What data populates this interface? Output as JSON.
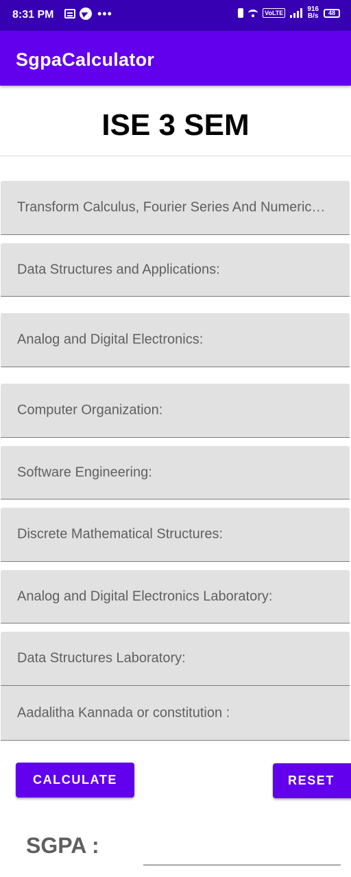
{
  "status_bar": {
    "time": "8:31 PM",
    "volte": "VoLTE",
    "speed_value": "916",
    "speed_unit": "B/s",
    "battery": "48"
  },
  "app_bar": {
    "title": "SgpaCalculator"
  },
  "header": {
    "title": "ISE 3 SEM"
  },
  "subjects": [
    {
      "hint": "Transform Calculus, Fourier Series And Numerical Techniques:"
    },
    {
      "hint": "Data Structures and Applications:"
    },
    {
      "hint": "Analog and Digital Electronics:"
    },
    {
      "hint": "Computer Organization:"
    },
    {
      "hint": "Software Engineering:"
    },
    {
      "hint": "Discrete Mathematical Structures:"
    },
    {
      "hint": "Analog and Digital Electronics Laboratory:"
    },
    {
      "hint": "Data Structures Laboratory:"
    },
    {
      "hint": "Aadalitha Kannada or constitution :"
    }
  ],
  "actions": {
    "calculate_label": "CALCULATE",
    "reset_label": "RESET"
  },
  "result": {
    "label": "SGPA :",
    "value": ""
  },
  "colors": {
    "primary": "#6200ee",
    "primary_dark": "#3700b3",
    "field_bg": "#e1e1e1"
  },
  "icons": [
    "message-icon",
    "telegram-icon",
    "more-dots-icon",
    "vibrate-icon",
    "wifi-icon",
    "signal-icon",
    "battery-icon"
  ]
}
